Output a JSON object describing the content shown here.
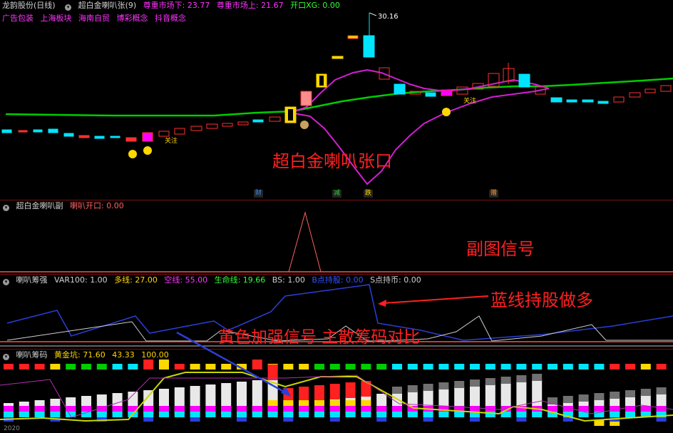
{
  "main": {
    "header": {
      "stock": "龙韵股份(日线)",
      "indicator": "超白金喇叭张(9)",
      "line1": "尊重市场下: 23.77",
      "line2": "尊重市场上: 21.67",
      "line3": "开口XG: 0.00"
    },
    "concepts": [
      "广告包装",
      "上海板块",
      "海南自贸",
      "博彩概念",
      "抖音概念"
    ],
    "price_high_label": "30.16",
    "attention_label": "关注",
    "big_caption": "超白金喇叭张口",
    "event_tags": [
      {
        "text": "财",
        "color": "#3a8cff"
      },
      {
        "text": "减",
        "color": "#2ecc2e"
      },
      {
        "text": "跌",
        "color": "#ffd700"
      },
      {
        "text": "赠",
        "color": "#ff9933"
      }
    ]
  },
  "sub1": {
    "header": {
      "title": "超白金喇叭副",
      "value": "喇叭开口: 0.00"
    },
    "big_caption": "副图信号"
  },
  "sub2": {
    "header": {
      "title": "喇叭筹强",
      "var": "VAR100: 1.00",
      "duo": "多线: 27.00",
      "kong": "空线: 55.00",
      "life": "生命线: 19.66",
      "bs": "BS: 1.00",
      "b": "B点持股: 0.00",
      "s": "S点持币: 0.00"
    },
    "big_caption": "蓝线持股做多",
    "big_caption2": "黄色加强信号 主散筹码对比"
  },
  "sub3": {
    "header": {
      "title": "喇叭筹码",
      "gold": "黄金坑: 71.60",
      "v2": "43.33",
      "v3": "100.00"
    },
    "axis_bottom": "2020"
  },
  "chart_data": [
    {
      "type": "candlestick",
      "title": "超白金喇叭张(9)",
      "annotations": [
        "30.16",
        "关注",
        "超白金喇叭张口"
      ],
      "series": [
        {
          "name": "尊重市场下",
          "value": 23.77,
          "color": "#ff00ff"
        },
        {
          "name": "尊重市场上",
          "value": 21.67,
          "color": "#ff00ff"
        },
        {
          "name": "开口XG",
          "value": 0.0,
          "color": "#00cc00"
        }
      ]
    },
    {
      "type": "line",
      "title": "超白金喇叭副",
      "series": [
        {
          "name": "喇叭开口",
          "value": 0.0,
          "color": "#ff6060"
        }
      ]
    },
    {
      "type": "line",
      "title": "喇叭筹强",
      "series": [
        {
          "name": "VAR100",
          "value": 1.0
        },
        {
          "name": "多线",
          "value": 27.0,
          "color": "#ffd700"
        },
        {
          "name": "空线",
          "value": 55.0,
          "color": "#ff00ff"
        },
        {
          "name": "生命线",
          "value": 19.66,
          "color": "#00ff00"
        },
        {
          "name": "BS",
          "value": 1.0
        },
        {
          "name": "B点持股",
          "value": 0.0,
          "color": "#3355ff"
        },
        {
          "name": "S点持币",
          "value": 0.0
        }
      ]
    },
    {
      "type": "bar",
      "title": "喇叭筹码",
      "series": [
        {
          "name": "黄金坑",
          "value": 71.6,
          "color": "#ffd700"
        },
        {
          "name": "",
          "value": 43.33
        },
        {
          "name": "",
          "value": 100.0
        }
      ]
    }
  ],
  "colors": {
    "up": "#ff3030",
    "down": "#00e5ff",
    "magenta": "#ff00ff",
    "green": "#00cc00",
    "yellow": "#ffd700",
    "blue": "#2b3fd6",
    "caption_red": "#ff2020"
  }
}
